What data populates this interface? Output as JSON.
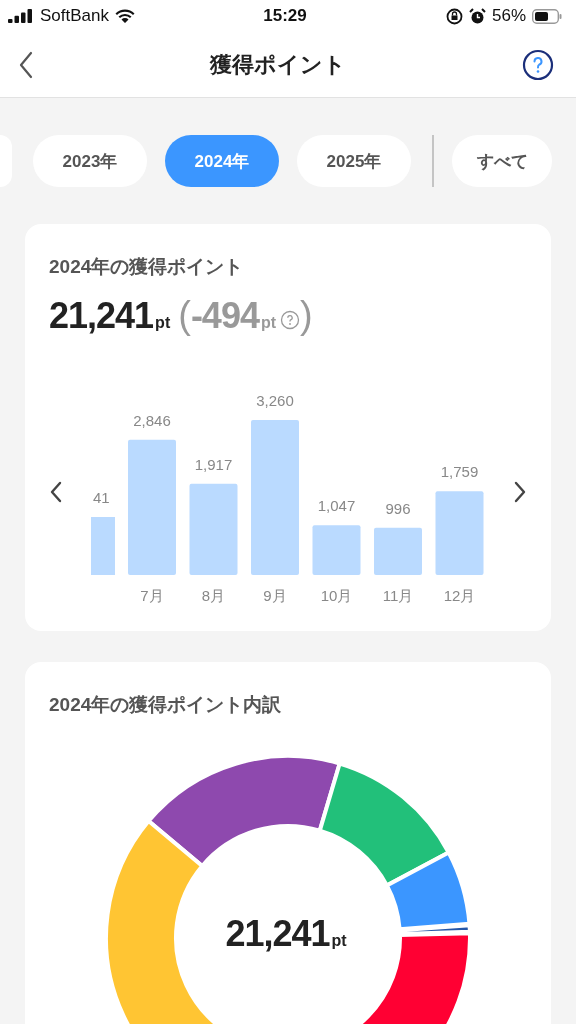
{
  "status_bar": {
    "carrier": "SoftBank",
    "time": "15:29",
    "battery": "56%"
  },
  "nav": {
    "title": "獲得ポイント"
  },
  "year_tabs": [
    {
      "label": "2023年",
      "selected": false
    },
    {
      "label": "2024年",
      "selected": true
    },
    {
      "label": "2025年",
      "selected": false
    }
  ],
  "all_tab": {
    "label": "すべて",
    "selected": false
  },
  "points_card": {
    "title": "2024年の獲得ポイント",
    "total": "21,241",
    "total_unit": "pt",
    "diff_open": "(",
    "diff": "-494",
    "diff_unit": "pt",
    "diff_close": ")",
    "cut_bar_label": "41",
    "chart_data": {
      "type": "bar",
      "categories": [
        "7月",
        "8月",
        "9月",
        "10月",
        "11月",
        "12月"
      ],
      "values": [
        2846,
        1917,
        3260,
        1047,
        996,
        1759
      ],
      "data_labels": true,
      "value_labels": [
        "2,846",
        "1,917",
        "3,260",
        "1,047",
        "996",
        "1,759"
      ]
    }
  },
  "breakdown_card": {
    "title": "2024年の獲得ポイント内訳",
    "total": "21,241",
    "unit": "pt"
  }
}
